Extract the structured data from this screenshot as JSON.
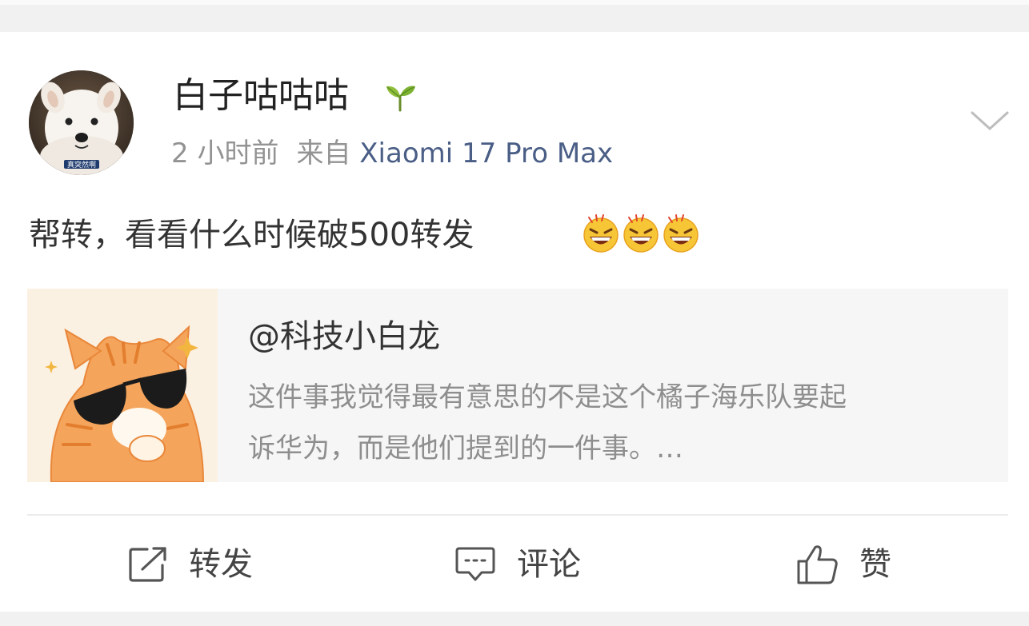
{
  "post": {
    "author_name": "白子咕咕咕",
    "time_ago": "2 小时前",
    "source_prefix": "来自",
    "source_device": "Xiaomi 17 Pro Max",
    "text": "帮转，看看什么时候破500转发",
    "emojis": [
      "laugh-emoji",
      "laugh-emoji",
      "laugh-emoji"
    ],
    "avatar_caption": "真突然啊"
  },
  "repost": {
    "author": "@科技小白龙",
    "text_lines": [
      "这件事我觉得最有意思的不是这个橘子海乐队要起",
      "诉华为，而是他们提到的一件事。…"
    ]
  },
  "actions": {
    "repost_label": "转发",
    "comment_label": "评论",
    "like_label": "赞"
  },
  "icons": {
    "badge": "sprout-icon",
    "menu": "chevron-down-icon",
    "repost": "share-square-icon",
    "comment": "comment-bubble-icon",
    "like": "thumbs-up-icon"
  },
  "colors": {
    "device_link": "#4a5e86",
    "meta_gray": "#939393",
    "card_bg": "#f6f6f6"
  }
}
